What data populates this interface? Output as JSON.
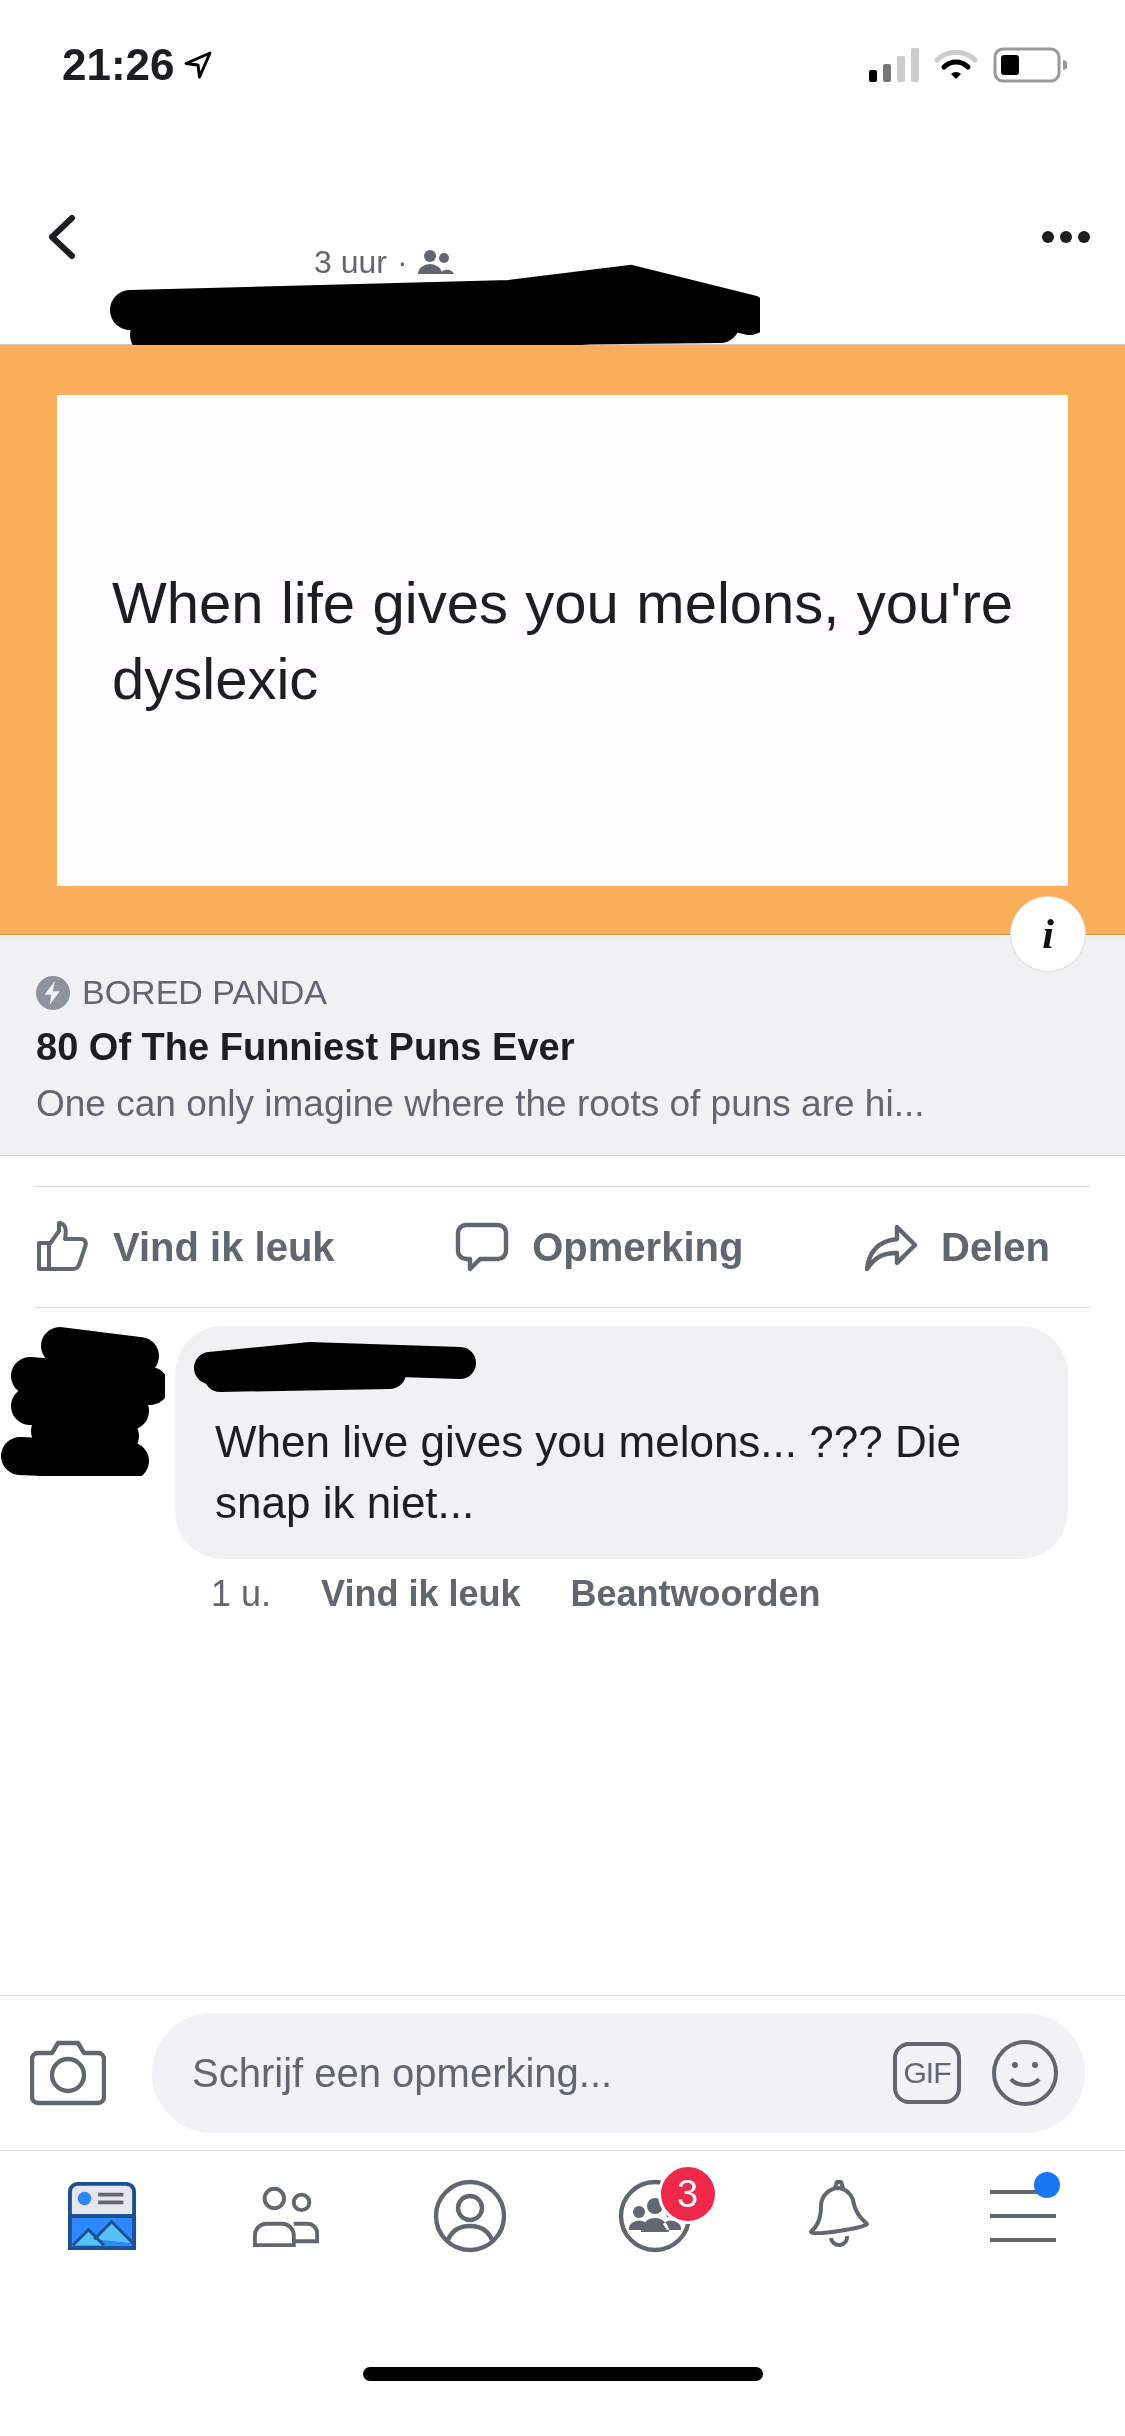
{
  "status_bar": {
    "time": "21:26"
  },
  "post": {
    "time": "3 uur",
    "separator": "·",
    "image_text": "When life gives you melons, you're dyslexic",
    "info_button": "i"
  },
  "link_preview": {
    "source": "BORED PANDA",
    "title": "80 Of The Funniest Puns Ever",
    "description": "One can only imagine where the roots of puns are hi..."
  },
  "actions": [
    {
      "kind": "like",
      "label": "Vind ik leuk"
    },
    {
      "kind": "comment",
      "label": "Opmerking"
    },
    {
      "kind": "share",
      "label": "Delen"
    }
  ],
  "comment": {
    "text": "When live gives you melons... ???  Die snap ik niet...",
    "time": "1 u.",
    "like": "Vind ik leuk",
    "reply": "Beantwoorden"
  },
  "composer": {
    "placeholder": "Schrijf een opmerking...",
    "gif": "GIF"
  },
  "tabs": [
    {
      "kind": "news",
      "selected": true
    },
    {
      "kind": "friends",
      "selected": false
    },
    {
      "kind": "profile",
      "selected": false
    },
    {
      "kind": "groups",
      "selected": false,
      "badge": "3"
    },
    {
      "kind": "notifications",
      "selected": false
    },
    {
      "kind": "menu",
      "selected": false,
      "dot": true
    }
  ]
}
